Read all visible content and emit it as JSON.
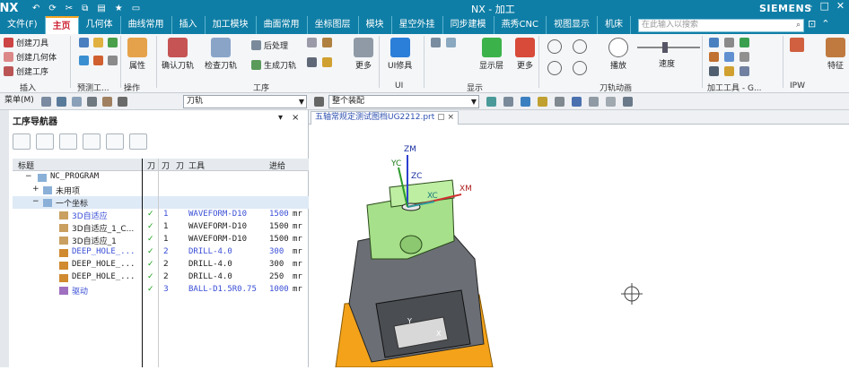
{
  "app": {
    "logo": "NX",
    "title": "NX - 加工",
    "brand": "SIEMENS"
  },
  "quick_access": {
    "file": "文件(F)"
  },
  "ribbon_tabs": [
    "主页",
    "几何体",
    "曲线常用",
    "插入",
    "加工模块",
    "曲面常用",
    "坐标图层",
    "模块",
    "星空外挂",
    "同步建模",
    "燕秀CNC",
    "视图显示",
    "机床"
  ],
  "search": {
    "placeholder": "在此输入以搜索"
  },
  "ribbon": {
    "create_tool": "创建刀具",
    "create_geometry": "创建几何体",
    "create_operation": "创建工序",
    "insert_group": "插入",
    "predict_group": "预测工...",
    "ops_group": "操作",
    "props": "属性",
    "confirm_tool": "确认刀轨",
    "check_tool": "检查刀轨",
    "post": "后处理",
    "gen_path": "生成刀轨",
    "more1": "更多",
    "ui_tools": "UI修具",
    "ui_group": "UI",
    "show_hide": "显示层",
    "more2": "更多",
    "display_group": "显示",
    "play": "播放",
    "speed": "速度",
    "anim_group": "刀轨动画",
    "process_tools": "加工工具 - G...",
    "ipw_group": "IPW",
    "feature": "特征",
    "process_group": "工序"
  },
  "toolbar2": {
    "menu": "菜单(M)",
    "filter": "刀轨",
    "assembly": "整个装配"
  },
  "navigator": {
    "title": "工序导航器",
    "headers": {
      "name": "标题",
      "tool_changed": "刀",
      "path": "刀",
      "num": "刀",
      "tool": "工具",
      "feed": "进给"
    },
    "rows": [
      {
        "name": "NC_PROGRAM",
        "status": "",
        "num": "",
        "tool": "",
        "feed": "",
        "style": "normal"
      },
      {
        "name": "未用项",
        "status": "",
        "num": "",
        "tool": "",
        "feed": "",
        "style": "normal"
      },
      {
        "name": "一个坐标",
        "status": "",
        "num": "",
        "tool": "",
        "feed": "",
        "style": "selected"
      },
      {
        "name": "3D自适应",
        "status": "✓",
        "num": "1",
        "tool": "WAVEFORM-D10",
        "feed": "1500",
        "unit": "mr",
        "style": "blue"
      },
      {
        "name": "3D自适应_1_C...",
        "status": "✓",
        "num": "1",
        "tool": "WAVEFORM-D10",
        "feed": "1500",
        "unit": "mr",
        "style": "normal"
      },
      {
        "name": "3D自适应_1",
        "status": "✓",
        "num": "1",
        "tool": "WAVEFORM-D10",
        "feed": "1500",
        "unit": "mr",
        "style": "normal"
      },
      {
        "name": "DEEP_HOLE_...",
        "status": "✓",
        "num": "2",
        "tool": "DRILL-4.0",
        "feed": "300",
        "unit": "mr",
        "style": "blue"
      },
      {
        "name": "DEEP_HOLE_...",
        "status": "✓",
        "num": "2",
        "tool": "DRILL-4.0",
        "feed": "300",
        "unit": "mr",
        "style": "normal"
      },
      {
        "name": "DEEP_HOLE_...",
        "status": "✓",
        "num": "2",
        "tool": "DRILL-4.0",
        "feed": "250",
        "unit": "mr",
        "style": "normal"
      },
      {
        "name": "驱动",
        "status": "✓",
        "num": "3",
        "tool": "BALL-D1.5R0.75",
        "feed": "1000",
        "unit": "mr",
        "style": "blue"
      }
    ]
  },
  "viewport": {
    "tab": "五轴常规定测试图档UG2212.prt",
    "axis_zm": "ZM",
    "axis_xm": "XM",
    "axis_yc": "YC",
    "axis_xc": "XC",
    "axis_zc": "ZC",
    "axis_y": "Y",
    "axis_x": "X"
  },
  "colors": {
    "title_bar": "#0f7ea6",
    "part_green": "#a6e08a",
    "fixture_gray": "#6b6f75",
    "vise_orange": "#f3a21a"
  }
}
